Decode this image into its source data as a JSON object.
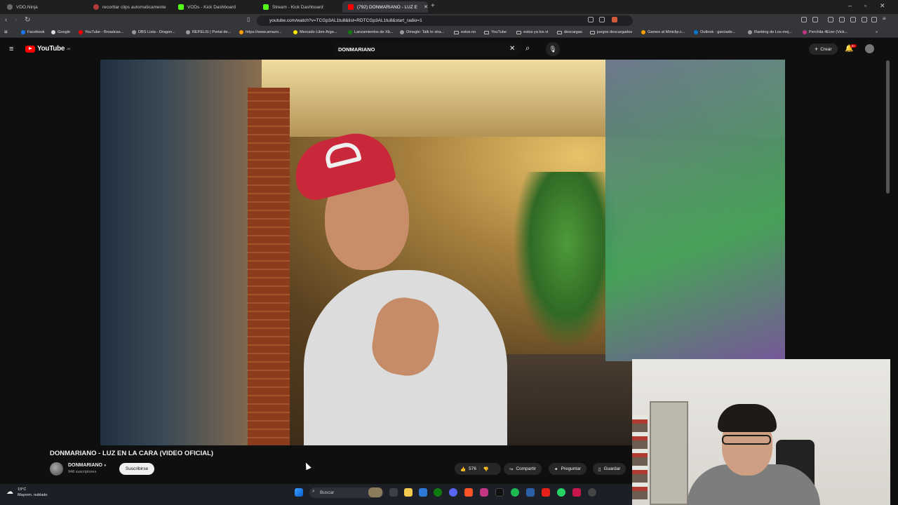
{
  "browser": {
    "tabs": [
      {
        "label": "VDO.Ninja",
        "color": "#6b6b6b"
      },
      {
        "label": "recorttar clips automaticamente",
        "color": "#b23a3a"
      },
      {
        "label": "VODs - Kick Dashboard",
        "color": "#53fc18"
      },
      {
        "label": "Stream - Kick Dashboard",
        "color": "#53fc18"
      },
      {
        "label": "(792) DONMARIANO - LUZ E",
        "color": "#ff0000"
      }
    ],
    "url": "youtube.com/watch?v=TCGp3AL1tu8&list=RDTCGp3AL1tu8&start_radio=1",
    "bookmarks": [
      "Facebook",
      "Google",
      "YouTube - Broadcas...",
      "DBS Lista - Dragon...",
      "REPELIS | Portal de...",
      "https://www.amazo...",
      "Mercado Libre Arge...",
      "Lanzamientos de Xb...",
      "Omegle: Talk to stra...",
      "estos no",
      "YouTube",
      "estos ya los vi",
      "descargas",
      "juegos descargados",
      "Games at Miniclip.c...",
      "Outlook - garciade...",
      "Ranking de Los mej...",
      "Perchita 4Ever (Vick..."
    ]
  },
  "youtube": {
    "logo_text": "YouTube",
    "logo_region": "AR",
    "search_value": "DONMARIANO",
    "create_label": "Crear",
    "notification_badge": "9+",
    "video_title": "DONMARIANO - LUZ EN LA CARA (VIDEO OFICIAL)",
    "channel_name": "DONMARIANO",
    "subscribers": "948 suscriptores",
    "subscribe_label": "Suscribirse",
    "like_count": "576",
    "share_label": "Compartir",
    "ask_label": "Preguntar",
    "save_label": "Guardar"
  },
  "taskbar": {
    "temperature": "19°C",
    "weather": "Mayorm. nublado",
    "search_placeholder": "Buscar"
  },
  "colors": {
    "yt_red": "#ff0000",
    "background": "#0f0f0f"
  }
}
